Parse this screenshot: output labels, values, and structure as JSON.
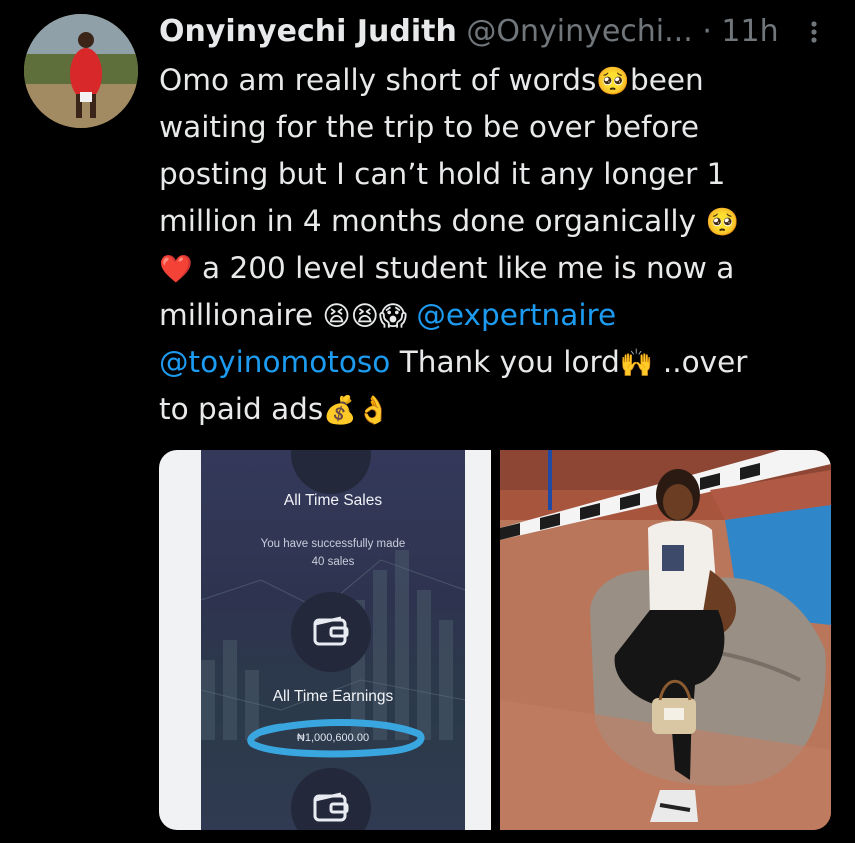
{
  "tweet": {
    "author_name": "Onyinyechi Judith",
    "author_handle": "@Onyinyechi...",
    "separator": "·",
    "time": "11h",
    "more_icon": "more-vertical-icon",
    "lines": [
      [
        {
          "t": "text",
          "v": "Omo am really short of words"
        },
        {
          "t": "emoji",
          "v": "🥺"
        },
        {
          "t": "text",
          "v": "been"
        }
      ],
      [
        {
          "t": "text",
          "v": "waiting for the trip to be over before"
        }
      ],
      [
        {
          "t": "text",
          "v": "posting but I can’t hold it any longer 1"
        }
      ],
      [
        {
          "t": "text",
          "v": "million in 4 months done organically "
        },
        {
          "t": "emoji",
          "v": "🥺"
        }
      ],
      [
        {
          "t": "emoji",
          "v": "❤️"
        },
        {
          "t": "text",
          "v": " a 200 level student like me is now a"
        }
      ],
      [
        {
          "t": "text",
          "v": "millionaire "
        },
        {
          "t": "emoji",
          "v": "😫😫😱"
        },
        {
          "t": "text",
          "v": " "
        },
        {
          "t": "mention",
          "v": "@expertnaire"
        }
      ],
      [
        {
          "t": "mention",
          "v": "@toyinomotoso"
        },
        {
          "t": "text",
          "v": " Thank you lord"
        },
        {
          "t": "emoji",
          "v": "🙌"
        },
        {
          "t": "text",
          "v": " ..over"
        }
      ],
      [
        {
          "t": "text",
          "v": "to paid ads"
        },
        {
          "t": "emoji",
          "v": "💰👌"
        }
      ]
    ]
  },
  "media": {
    "screenshot": {
      "sales_title": "All Time Sales",
      "sales_message_line1": "You have successfully made",
      "sales_message_line2": "40 sales",
      "earnings_title": "All Time Earnings",
      "earnings_value": "₦1,000,600.00",
      "wallet_icon": "wallet-icon"
    },
    "photo": {
      "subject": "photo-of-woman-seated-on-rock"
    }
  },
  "colors": {
    "background": "#000000",
    "text": "#e7e9ea",
    "secondary": "#71767b",
    "mention": "#1d9bf0",
    "highlight_circle": "#3aa6e0"
  }
}
